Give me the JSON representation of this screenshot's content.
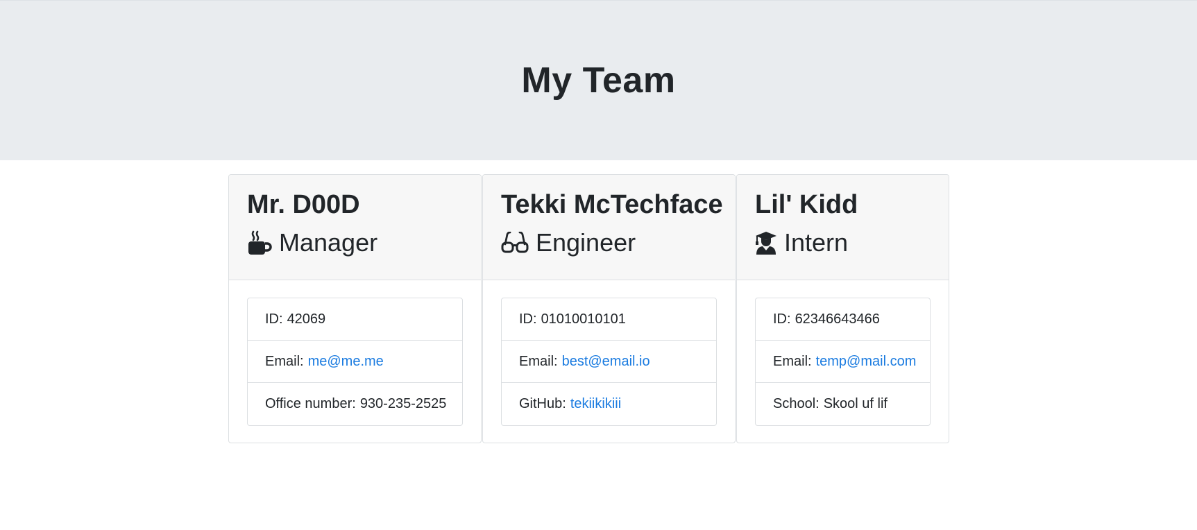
{
  "header": {
    "title": "My Team"
  },
  "cards": [
    {
      "name": "Mr. D00D",
      "role": "Manager",
      "role_icon": "coffee-mug-icon",
      "id_label": "ID:",
      "id": "42069",
      "email_label": "Email:",
      "email": "me@me.me",
      "extra_label": "Office number:",
      "extra": "930-235-2525"
    },
    {
      "name": "Tekki McTechface",
      "role": "Engineer",
      "role_icon": "glasses-icon",
      "id_label": "ID:",
      "id": "01010010101",
      "email_label": "Email:",
      "email": "best@email.io",
      "extra_label": "GitHub:",
      "extra": "tekiikikiii"
    },
    {
      "name": "Lil' Kidd",
      "role": "Intern",
      "role_icon": "graduate-icon",
      "id_label": "ID:",
      "id": "62346643466",
      "email_label": "Email:",
      "email": "temp@mail.com",
      "extra_label": "School:",
      "extra": "Skool uf lif"
    }
  ],
  "colors": {
    "jumbotron_bg": "#e9ecef",
    "card_header_bg": "#f7f7f7",
    "link": "#1a7be0",
    "text": "#212529"
  }
}
